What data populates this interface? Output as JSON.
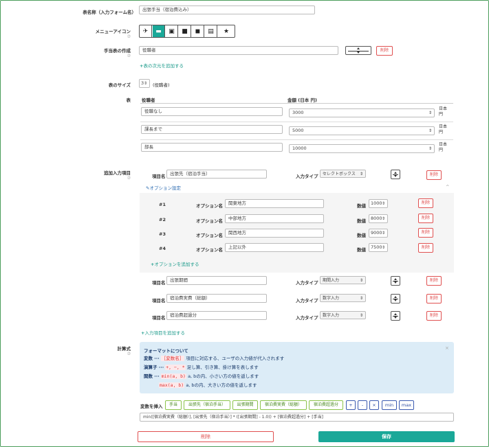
{
  "form": {
    "name_label": "表名称（入力フォーム名）",
    "name_value": "出張手当（宿泊費込み）",
    "menu_icon_label": "メニューアイコン",
    "table_create_label": "手当表の作成",
    "dimension_value": "役職者",
    "delete": "削除",
    "add_dimension": "表の次元を追加する",
    "size_label": "表のサイズ",
    "size_value": "3",
    "size_unit": "(役職者)",
    "table_label": "表",
    "col_role": "役職者",
    "col_amount": "金額 (日本 円)",
    "help": "⑦"
  },
  "rows": [
    {
      "role": "役職なし",
      "amount": "3000"
    },
    {
      "role": "課長まで",
      "amount": "5000"
    },
    {
      "role": "部長",
      "amount": "10000"
    }
  ],
  "unit": {
    "a": "日本",
    "b": "円"
  },
  "extra": {
    "label": "追加入力項目",
    "item_label": "項目名",
    "type_label": "入力タイプ",
    "item1": "出張先（宿泊手当）",
    "type1": "セレクトボックス",
    "option_settings": "オプション設定",
    "caret": "^",
    "option_name_label": "オプション名",
    "value_label": "数値",
    "options": [
      {
        "no": "#1",
        "name": "関東地方",
        "value": "1000"
      },
      {
        "no": "#2",
        "name": "中部地方",
        "value": "8000"
      },
      {
        "no": "#3",
        "name": "関西地方",
        "value": "9000"
      },
      {
        "no": "#4",
        "name": "上記以外",
        "value": "7500"
      }
    ],
    "add_option": "オプションを追加する",
    "items": [
      {
        "name": "出張期間",
        "type": "期間入力"
      },
      {
        "name": "宿泊費実費（総額）",
        "type": "数字入力"
      },
      {
        "name": "宿泊費超過分",
        "type": "数字入力"
      }
    ],
    "add_item": "入力項目を追加する"
  },
  "formula": {
    "label": "計算式",
    "box_title": "フォーマットについて",
    "close": "×",
    "l1a": "変数 ···",
    "l1tag": "［変数名］",
    "l1b": "項目に対応する、ユーザの入力値が代入されます",
    "l2a": "演算子 ···",
    "l2ops": "+, −, *",
    "l2b": "足し算、引き算、掛け算を表します",
    "l3a": "関数 ···",
    "l3fn": "min(a, b)",
    "l3b": "a, bの内、小さい方の値を返します",
    "l4fn": "max(a, b)",
    "l4b": "a, bの内、大きい方の値を返します",
    "insert_label": "変数を挿入",
    "vars": [
      "手当",
      "出張先（宿泊手当）",
      "出張期間",
      "宿泊費実費（総額）",
      "宿泊費超過分"
    ],
    "ops": [
      "+",
      "-",
      "×",
      "min",
      "max"
    ],
    "expression": "min([宿泊費実費（総額）], [出張先（宿泊手当）] * ([出張期間] - 1.0)) + [宿泊費超過分] + [手当]"
  },
  "footer": {
    "delete": "削除",
    "save": "保存"
  },
  "colors": {
    "accent": "#1aa898",
    "danger": "#e05050",
    "info_bg": "#dcecf7"
  }
}
